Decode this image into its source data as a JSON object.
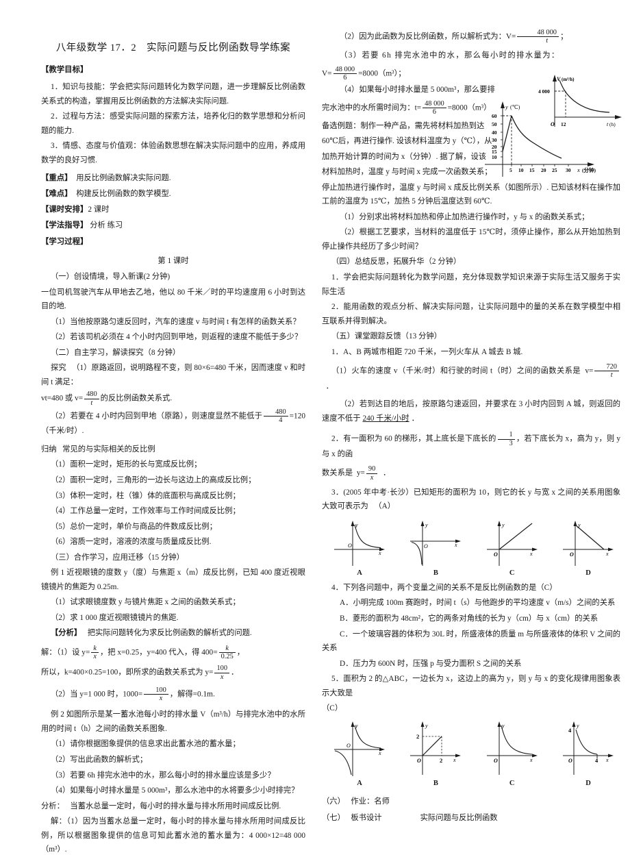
{
  "document": {
    "title": "八年级数学 17．2　实际问题与反比例函数导学练案"
  },
  "left_column": {
    "objectives_head": "【教学目标】",
    "objectives": [
      "1．知识与技能：学会把实际问题转化为数学问题，进一步理解反比例函数关系式的构造，掌握用反比例函数的方法解决实际问题.",
      "2．过程与方法：感受实际问题的探索方法，培养化归的数学思想和分析问题的能力.",
      "3．情感、态度与价值观：体验函数思想在解决实际问题中的应用，养成用数学的良好习惯."
    ],
    "key_point_head": "【重点】",
    "key_point_text": "用反比例函数解决实际问题.",
    "difficulty_head": "【难点】",
    "difficulty_text": "构建反比例函数的数学模型.",
    "hours_head": "【课时安排】",
    "hours_text": "2 课时",
    "guidance_head": "【学法指导】",
    "guidance_text": "分析 练习",
    "process_head": "【学习过程】",
    "lesson_label": "第 1 课时",
    "section_one": "（一）创设情境，导入新课(2 分钟)",
    "scenario": "一位司机驾驶汽车从甲地去乙地，他以 80 千米／时的平均速度用 6 小时到达目的地.",
    "q1": "（1）当他按原路匀速反回时，汽车的速度 v 与时间 t 有怎样的函数关系？",
    "q2": "（2）若该司机必须在 4 个小时内回到甲地，则返程的速度不能低于多少？",
    "section_two": "（二）自主学习，解读探究（8 分钟）",
    "explore_label": "探究",
    "explore1_a": "（1）原路返回，说明路程不变，则 80×6=480 千米，因而速度 v 和时间 t 满足：",
    "explore1_b_pre": "vt=480 或 v=",
    "explore1_frac_num": "480",
    "explore1_frac_den": "t",
    "explore1_b_post": "的反比例函数关系式.",
    "explore2_pre": "（2）若要在 4 小时内回到甲地（原路），则速度显然不能低于",
    "explore2_frac_num": "480",
    "explore2_frac_den": "4",
    "explore2_post": "=120（千米/时）.",
    "summary_label": "归纳",
    "summary_title": "常见的与实际相关的反比例",
    "summary_items": [
      "（1）面积一定时，矩形的长与宽成反比例；",
      "（2）面积一定时，三角形的一边长与这边上的高成反比例；",
      "（3）体积一定时，柱（锥）体的底面积与高成反比例；",
      "（4）工作总量一定时，工作效率与工作时间成反比例；",
      "（5）总价一定时，单价与商品的件数成反比例；",
      "（6）溶质一定时，溶液的浓度与质量成反比例."
    ],
    "section_three": "（三）合作学习，应用迁移（15 分钟）",
    "ex1_stem": "例 1 近视眼镜的度数 y（度）与焦距 x（m）成反比例，已知 400 度近视眼镜镜片的焦距为 0.25m.",
    "ex1_q1": "（1）试求眼镜度数 y 与镜片焦距 x 之间的函数关系式；",
    "ex1_q2": "（2）求 1 000 度近视眼镜镜片的焦距.",
    "ex1_analysis_head": "【分析】",
    "ex1_analysis_text": "把实际问题转化为求反比例函数的解析式的问题.",
    "ex1_sol1_pre": "解：（1）设 y=",
    "ex1_sol1_f1_num": "k",
    "ex1_sol1_f1_den": "x",
    "ex1_sol1_mid": "，把 x=0.25，y=400 代入，得 400=",
    "ex1_sol1_f2_num": "k",
    "ex1_sol1_f2_den": "0.25",
    "ex1_sol1_post": "，",
    "ex1_sol2_pre": "所以，k=400×0.25=100，即所求的函数关系式为 y=",
    "ex1_sol2_f_num": "100",
    "ex1_sol2_f_den": "x",
    "ex1_sol2_post": "．",
    "ex1_sol3_pre": "（2）当 y=1 000 时，1000=",
    "ex1_sol3_f_num": "100",
    "ex1_sol3_f_den": "x",
    "ex1_sol3_post": "，解得=0.1m.",
    "ex2_stem": "例 2 如图所示是某一蓄水池每小时的排水量 V（m³/h）与排完水池中的水所用的时间 t（h）之间的函数关系图象.",
    "ex2_q1": "（1）请你根据图象提供的信息求出此蓄水池的蓄水量；",
    "ex2_q2": "（2）写出此函数的解析式；",
    "ex2_q3": "（3）若要 6h 排完水池中的水，那么每小时的排水量应该是多少？",
    "ex2_q4": "（4）如果每小时排水量是 5 000m³，那么水池中的水将要多少小时排完？",
    "ex2_analysis_label": "分析：",
    "ex2_analysis_text": "当蓄水总量一定时，每小时的排水量与排水所用时间成反比例.",
    "ex2_sol1": "解：（1）因为当蓄水总量一定时，每小时的排水量与排水所用时间成反比例，所以根据图象提供的信息可知此蓄水池的蓄水量为：4 000×12=48 000（m³）."
  },
  "right_column": {
    "ex2_sol2_pre": "（2）因为此函数为反比例函数，所以解析式为：V=",
    "ex2_sol2_f_num": "48 000",
    "ex2_sol2_f_den": "t",
    "ex2_sol2_post": "；",
    "ex2_sol3_q": "（3）若要 6h 排完水池中的水，那么每小时的排水量为：",
    "ex2_sol3_pre": "V=",
    "ex2_sol3_f_num": "48 000",
    "ex2_sol3_f_den": "6",
    "ex2_sol3_post": "=8000（m³）；",
    "ex2_sol4_q": "（4）如果每小时排水量是 5 000m³，那么要排",
    "ex2_sol4_pre": "完水池中的水所需时间为：t=",
    "ex2_sol4_f_num": "48 000",
    "ex2_sol4_f_den": "6",
    "ex2_sol4_post": "=8000（m³）",
    "alt_ex_1": "备选例题：制作一种产品，需先将材料加热到达",
    "alt_ex_2": "60℃后，再进行操作. 设该材料温度为 y（℃），从",
    "alt_ex_3": "加热开始计算的时间为 x（分钟）. 据了解，设该",
    "alt_ex_4": "材料加热时，温度 y 与时间 x 完成一次函数关系；",
    "alt_ex_5": "停止加热进行操作时，温度 y 与时间 x 成反比例关系（如图所示）. 已知该材料在操作加工前的温度为 15℃，加热 5 分钟后温度达到 60℃.",
    "alt_q1": "（1）分别求出将材料加热和停止加热进行操作时，y 与 x 的函数关系式；",
    "alt_q2": "（2）根据工艺要求，当材料的温度低于 15℃时，须停止操作，那么从开始加热到停止操作共经历了多少时间？",
    "section_four": "（四）总结反思，拓展升华（2 分钟）",
    "reflect1": "1．学会把实际问题转化为数学问题，充分体现数学知识来源于实际生活又服务于实际生活",
    "reflect2": "2．能用函数的观点分析、解决实际问题，让实际问题中的量的关系在数学模型中相互联系并得到解决。",
    "section_five": "（五）课堂跟踪反馈（13 分钟）",
    "fb1_stem": "1．A、B 两城市相距 720 千米，一列火车从 A 城去 B 城.",
    "fb1_q1_pre": "（1）火车的速度 v（千米/时）和行驶的时间 t（时）之间的函数关系是",
    "fb1_q1_vpre": "v=",
    "fb1_q1_f_num": "720",
    "fb1_q1_f_den": "t",
    "fb1_q1_post": "．",
    "fb1_q2_pre": "（2）若到达目的地后，按原路匀速返回，并要求在 3 小时内回到 A 城，则返回的速度不低于",
    "fb1_q2_ans": "240 千米/小时",
    "fb1_q2_post": "．",
    "fb2_pre": "2．有一面积为 60 的梯形，其上底长是下底长的",
    "fb2_f1_num": "1",
    "fb2_f1_den": "3",
    "fb2_mid": "，若下底长为 x，高为 y，则 y 与 x 的函",
    "fb2_ans_pre": "数关系是",
    "fb2_ypre": "y=",
    "fb2_f2_num": "90",
    "fb2_f2_den": "x",
    "fb2_post": "．",
    "fb3_stem": "3．(2005 年中考·长沙）已知矩形的面积为 10，则它的长 y 与宽 x 之间的关系用图象大致可表示为",
    "fb3_answer": "（A）",
    "fb3_options": [
      "A",
      "B",
      "C",
      "D"
    ],
    "fb4_stem": "4．下列各问题中，两个变量之间的关系不是反比例函数的是（C）",
    "fb4_options": [
      "A．小明完成 100m 赛跑时，时间 t（s）与他跑步的平均速度 v（m/s）之间的关系",
      "B．菱形的面积为 48cm²，它的两条对角线的长为 y（cm）与 x（cm）的关系",
      "C．一个玻璃容器的体积为 30L 时，所盛液体的质量 m 与所盛液体的体积 V 之间的关系",
      "D．压力为 600N 时，压强 p 与受力面积 S 之间的关系"
    ],
    "fb5_stem": "5．面积为 2 的△ABC，一边长为 x，这边上的高为 y，则 y 与 x 的变化规律用图象表示大致是",
    "fb5_answer": "（C）",
    "fb5_options": [
      "A",
      "B",
      "C",
      "D"
    ],
    "section_six_label": "（六）",
    "section_six_text": "作业：名师",
    "section_seven_label": "（七）",
    "section_seven_text": "板书设计",
    "section_seven_title": "实际问题与反比例函数"
  },
  "chart_data": [
    {
      "id": "drain-rate-graph",
      "type": "line",
      "curve": "inverse-proportional",
      "title": "",
      "ylabel": "V(m³/h)",
      "xlabel": "t(h)",
      "origin_label": "O",
      "y_ticks": [
        "4 000"
      ],
      "x_ticks": [
        "12"
      ],
      "marked_point": {
        "x": 12,
        "y": 4000
      },
      "dashed_guides": true,
      "equation": "V=48000/t"
    },
    {
      "id": "temperature-time-graph",
      "type": "line",
      "curve": "linear-then-inverse",
      "title": "",
      "ylabel": "y(℃)",
      "xlabel": "x(分钟)",
      "origin_label": "",
      "y_ticks": [
        "10",
        "15",
        "20",
        "30",
        "40",
        "50",
        "60"
      ],
      "x_ticks": [
        "5",
        "10",
        "15",
        "20",
        "25",
        "30"
      ],
      "peak_point": {
        "x": 5,
        "y": 60
      },
      "start_point": {
        "x": 0,
        "y": 15
      },
      "dashed_guides": true
    },
    {
      "id": "fb3-option-A",
      "type": "line",
      "curve": "hyperbola-quadrant-1",
      "ylabel": "y",
      "xlabel": "x",
      "origin_label": "O",
      "label": "A"
    },
    {
      "id": "fb3-option-B",
      "type": "line",
      "curve": "hyperbola-quadrant-3",
      "ylabel": "y",
      "xlabel": "x",
      "origin_label": "O",
      "label": "B"
    },
    {
      "id": "fb3-option-C",
      "type": "line",
      "curve": "straight-line-positive-slope",
      "ylabel": "y",
      "xlabel": "x",
      "origin_label": "O",
      "label": "C"
    },
    {
      "id": "fb3-option-D",
      "type": "line",
      "curve": "straight-line-negative-slope",
      "ylabel": "y",
      "xlabel": "x",
      "origin_label": "O",
      "label": "D"
    },
    {
      "id": "fb5-option-A",
      "type": "line",
      "curve": "hyperbola-both-branches",
      "ylabel": "y",
      "xlabel": "x",
      "origin_label": "O",
      "label": "A"
    },
    {
      "id": "fb5-option-B",
      "type": "line",
      "curve": "segment-through-origin",
      "ylabel": "y",
      "xlabel": "x",
      "origin_label": "O",
      "y_ticks": [
        "2"
      ],
      "x_ticks": [
        "2"
      ],
      "label": "B"
    },
    {
      "id": "fb5-option-C",
      "type": "line",
      "curve": "hyperbola-quadrant-1",
      "ylabel": "y",
      "xlabel": "x",
      "origin_label": "O",
      "label": "C"
    },
    {
      "id": "fb5-option-D",
      "type": "line",
      "curve": "hyperbola-quadrant-1-truncated",
      "ylabel": "y",
      "xlabel": "x",
      "origin_label": "O",
      "y_ticks": [
        "4"
      ],
      "x_ticks": [
        "4"
      ],
      "label": "D"
    }
  ]
}
